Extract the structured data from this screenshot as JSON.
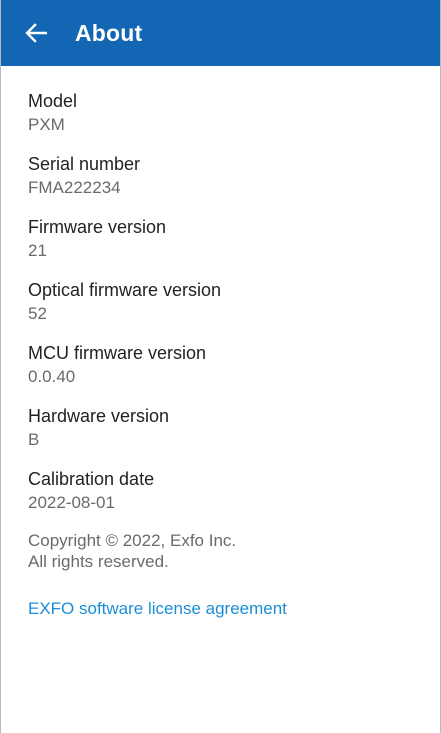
{
  "header": {
    "title": "About",
    "back_icon": "arrow-left-icon",
    "color": "#1366b3"
  },
  "fields": [
    {
      "label": "Model",
      "value": "PXM"
    },
    {
      "label": "Serial number",
      "value": "FMA222234"
    },
    {
      "label": "Firmware version",
      "value": "21"
    },
    {
      "label": "Optical firmware version",
      "value": "52"
    },
    {
      "label": "MCU firmware version",
      "value": "0.0.40"
    },
    {
      "label": "Hardware version",
      "value": "B"
    },
    {
      "label": "Calibration date",
      "value": "2022-08-01"
    }
  ],
  "copyright": {
    "line1": "Copyright © 2022, Exfo Inc.",
    "line2": "All rights reserved."
  },
  "license_link": "EXFO software license agreement",
  "link_color": "#1b8ed6"
}
